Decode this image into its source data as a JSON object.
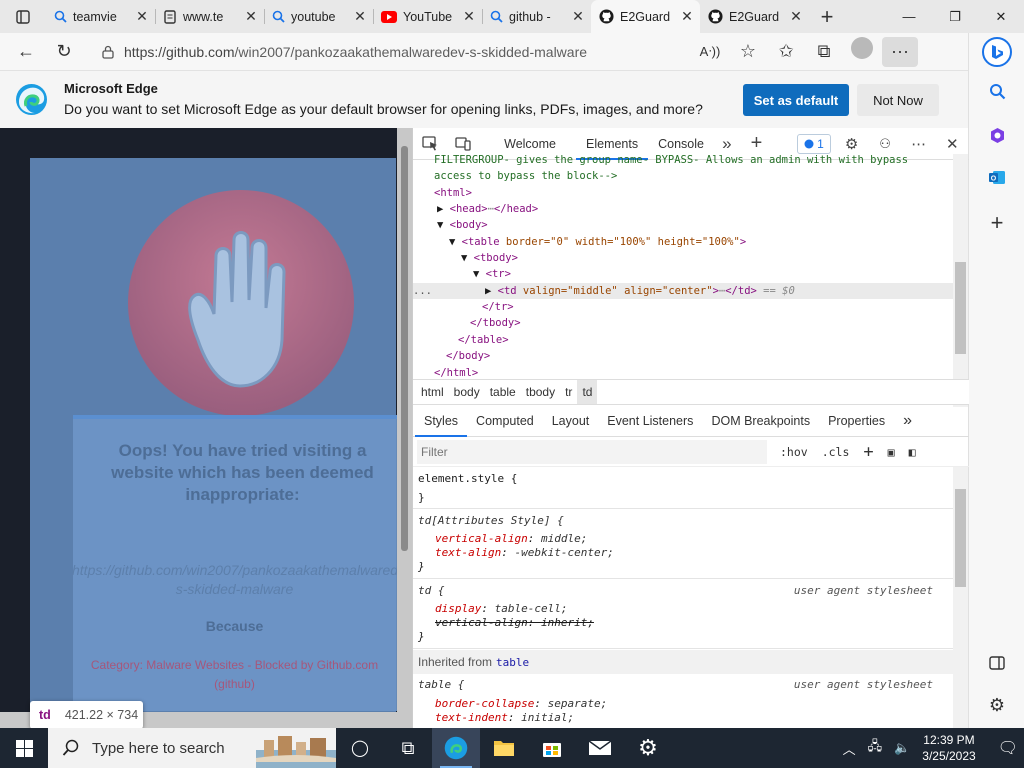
{
  "browser": {
    "tabs": [
      {
        "label": "teamvie",
        "icon": "search-icon"
      },
      {
        "label": "www.te",
        "icon": "page-icon"
      },
      {
        "label": "youtube",
        "icon": "search-icon"
      },
      {
        "label": "YouTube",
        "icon": "youtube-icon"
      },
      {
        "label": "github -",
        "icon": "search-icon"
      },
      {
        "label": "E2Guard",
        "icon": "github-icon",
        "active": true
      },
      {
        "label": "E2Guard",
        "icon": "github-icon"
      }
    ],
    "url": {
      "host": "https://github.com",
      "path": "/win2007/pankozaakathemalwaredev-s-skidded-malware"
    }
  },
  "infobar": {
    "title": "Microsoft Edge",
    "text": "Do you want to set Microsoft Edge as your default browser for opening links, PDFs, images, and more?",
    "primary_label": "Set as default",
    "secondary_label": "Not Now"
  },
  "page": {
    "message": "Oops! You have tried visiting a website which has been deemed inappropriate:",
    "blocked_url": "https://github.com/win2007/pankozaakathemalwaredev-s-skidded-malware",
    "because": "Because",
    "reason": "Category: Malware Websites - Blocked by Github.com (github)",
    "tooltip_tag": "td",
    "tooltip_dims": "421.22 × 734"
  },
  "devtools": {
    "tabs": [
      "Welcome",
      "Elements",
      "Console"
    ],
    "active_tab": "Elements",
    "issues_count": "1",
    "dom": {
      "comment1": "FILTERGROUP- gives the group name- BYPASS- Allows an admin with with bypass",
      "comment2": "access to bypass the block-->",
      "html_open": "<html>",
      "head": "<head>",
      "head_close": "</head>",
      "body_open": "<body>",
      "table_tag": "<table",
      "table_attrs": "border=\"0\" width=\"100%\" height=\"100%\"",
      "tbody_open": "<tbody>",
      "tr_open": "<tr>",
      "td_tag": "<td",
      "td_attrs": "valign=\"middle\" align=\"center\"",
      "td_close": "</td>",
      "td_ref": "== $0",
      "tr_close": "</tr>",
      "tbody_close": "</tbody>",
      "table_close": "</table>",
      "body_close": "</body>",
      "html_close": "</html>",
      "selected_marker": "..."
    },
    "breadcrumbs": [
      "html",
      "body",
      "table",
      "tbody",
      "tr",
      "td"
    ],
    "styles_tabs": [
      "Styles",
      "Computed",
      "Layout",
      "Event Listeners",
      "DOM Breakpoints",
      "Properties"
    ],
    "filter_placeholder": "Filter",
    "hov": ":hov",
    "cls": ".cls",
    "rules": {
      "element_style": "element.style {",
      "close": "}",
      "attr_selector": "td[Attributes Style] {",
      "valign_name": "vertical-align",
      "valign_value": "middle;",
      "talign_name": "text-align",
      "talign_value": "-webkit-center;",
      "td_selector": "td {",
      "ua_origin": "user agent stylesheet",
      "display_name": "display",
      "display_value": "table-cell;",
      "va_inherit": "vertical-align: inherit;",
      "inherited_label": "Inherited from",
      "inherited_src": "table",
      "table_selector": "table {",
      "bc_name": "border-collapse",
      "bc_value": "separate;",
      "ti_name": "text-indent",
      "ti_value": "initial;"
    }
  },
  "taskbar": {
    "search_placeholder": "Type here to search",
    "time": "12:39 PM",
    "date": "3/25/2023"
  },
  "colors": {
    "edge_blue": "#0f6cbd",
    "devtools_tag": "#881280",
    "devtools_link": "#1a73e8"
  }
}
